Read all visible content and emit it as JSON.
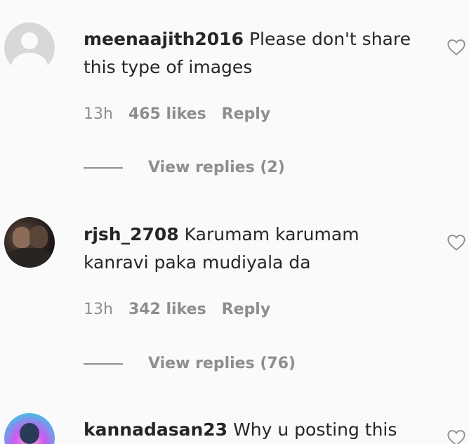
{
  "comments": [
    {
      "username": "meenaajith2016",
      "text": "Please don't share this type of images",
      "time": "13h",
      "likes": "465 likes",
      "reply": "Reply",
      "view_replies": "View replies (2)",
      "avatar": "default-avatar"
    },
    {
      "username": "rjsh_2708",
      "text": "Karumam karumam kanravi paka mudiyala da",
      "time": "13h",
      "likes": "342 likes",
      "reply": "Reply",
      "view_replies": "View replies (76)",
      "avatar": "photo-avatar"
    },
    {
      "username": "kannadasan23",
      "text": "Why u posting this",
      "avatar": "colorful-avatar"
    }
  ],
  "icons": {
    "like": "heart-outline-icon"
  },
  "colors": {
    "text": "#262626",
    "secondary": "#8e8e8e",
    "background": "#fafafa"
  }
}
